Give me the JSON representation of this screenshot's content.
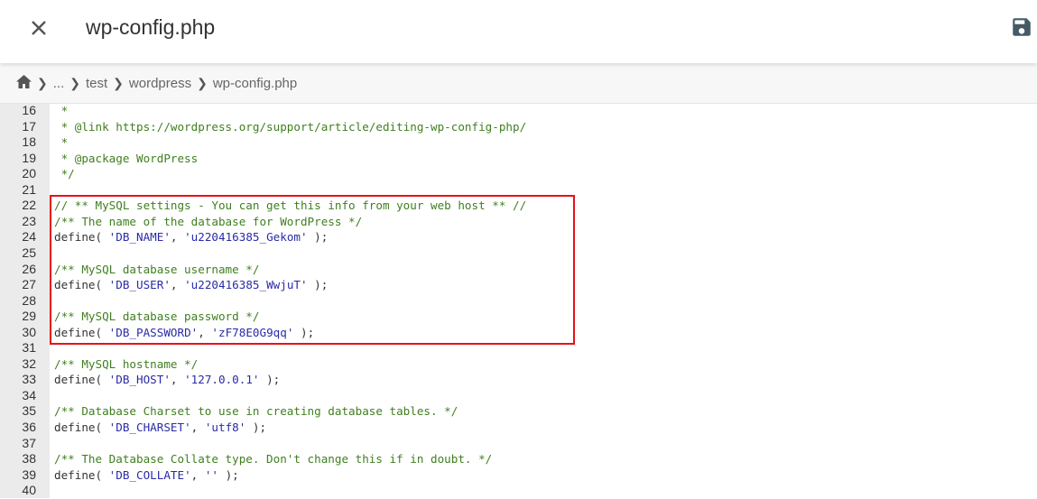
{
  "header": {
    "title": "wp-config.php",
    "close_icon": "close-icon",
    "save_icon": "save-icon"
  },
  "breadcrumb": [
    "...",
    "test",
    "wordpress",
    "wp-config.php"
  ],
  "colors": {
    "comment": "#3f7f1f",
    "string": "#2a2aa8",
    "highlight": "#e8101a"
  },
  "lines": [
    {
      "n": "16",
      "tokens": [
        {
          "t": " *",
          "c": "cm"
        }
      ]
    },
    {
      "n": "17",
      "tokens": [
        {
          "t": " * @link https://wordpress.org/support/article/editing-wp-config-php/",
          "c": "cm"
        }
      ]
    },
    {
      "n": "18",
      "tokens": [
        {
          "t": " *",
          "c": "cm"
        }
      ]
    },
    {
      "n": "19",
      "tokens": [
        {
          "t": " * @package WordPress",
          "c": "cm"
        }
      ]
    },
    {
      "n": "20",
      "tokens": [
        {
          "t": " */",
          "c": "cm"
        }
      ]
    },
    {
      "n": "21",
      "tokens": []
    },
    {
      "n": "22",
      "tokens": [
        {
          "t": "// ** MySQL settings - You can get this info from your web host ** //",
          "c": "cm"
        }
      ]
    },
    {
      "n": "23",
      "tokens": [
        {
          "t": "/** The name of the database for WordPress */",
          "c": "cm"
        }
      ]
    },
    {
      "n": "24",
      "tokens": [
        {
          "t": "define( ",
          "c": "df"
        },
        {
          "t": "'DB_NAME'",
          "c": "st"
        },
        {
          "t": ", ",
          "c": "df"
        },
        {
          "t": "'u220416385_Gekom'",
          "c": "st"
        },
        {
          "t": " );",
          "c": "df"
        }
      ]
    },
    {
      "n": "25",
      "tokens": []
    },
    {
      "n": "26",
      "tokens": [
        {
          "t": "/** MySQL database username */",
          "c": "cm"
        }
      ]
    },
    {
      "n": "27",
      "tokens": [
        {
          "t": "define( ",
          "c": "df"
        },
        {
          "t": "'DB_USER'",
          "c": "st"
        },
        {
          "t": ", ",
          "c": "df"
        },
        {
          "t": "'u220416385_WwjuT'",
          "c": "st"
        },
        {
          "t": " );",
          "c": "df"
        }
      ]
    },
    {
      "n": "28",
      "tokens": []
    },
    {
      "n": "29",
      "tokens": [
        {
          "t": "/** MySQL database password */",
          "c": "cm"
        }
      ]
    },
    {
      "n": "30",
      "tokens": [
        {
          "t": "define( ",
          "c": "df"
        },
        {
          "t": "'DB_PASSWORD'",
          "c": "st"
        },
        {
          "t": ", ",
          "c": "df"
        },
        {
          "t": "'zF78E0G9qq'",
          "c": "st"
        },
        {
          "t": " );",
          "c": "df"
        }
      ]
    },
    {
      "n": "31",
      "tokens": []
    },
    {
      "n": "32",
      "tokens": [
        {
          "t": "/** MySQL hostname */",
          "c": "cm"
        }
      ]
    },
    {
      "n": "33",
      "tokens": [
        {
          "t": "define( ",
          "c": "df"
        },
        {
          "t": "'DB_HOST'",
          "c": "st"
        },
        {
          "t": ", ",
          "c": "df"
        },
        {
          "t": "'127.0.0.1'",
          "c": "st"
        },
        {
          "t": " );",
          "c": "df"
        }
      ]
    },
    {
      "n": "34",
      "tokens": []
    },
    {
      "n": "35",
      "tokens": [
        {
          "t": "/** Database Charset to use in creating database tables. */",
          "c": "cm"
        }
      ]
    },
    {
      "n": "36",
      "tokens": [
        {
          "t": "define( ",
          "c": "df"
        },
        {
          "t": "'DB_CHARSET'",
          "c": "st"
        },
        {
          "t": ", ",
          "c": "df"
        },
        {
          "t": "'utf8'",
          "c": "st"
        },
        {
          "t": " );",
          "c": "df"
        }
      ]
    },
    {
      "n": "37",
      "tokens": []
    },
    {
      "n": "38",
      "tokens": [
        {
          "t": "/** The Database Collate type. Don't change this if in doubt. */",
          "c": "cm"
        }
      ]
    },
    {
      "n": "39",
      "tokens": [
        {
          "t": "define( ",
          "c": "df"
        },
        {
          "t": "'DB_COLLATE'",
          "c": "st"
        },
        {
          "t": ", ",
          "c": "df"
        },
        {
          "t": "''",
          "c": "st"
        },
        {
          "t": " );",
          "c": "df"
        }
      ]
    },
    {
      "n": "40",
      "tokens": []
    }
  ]
}
